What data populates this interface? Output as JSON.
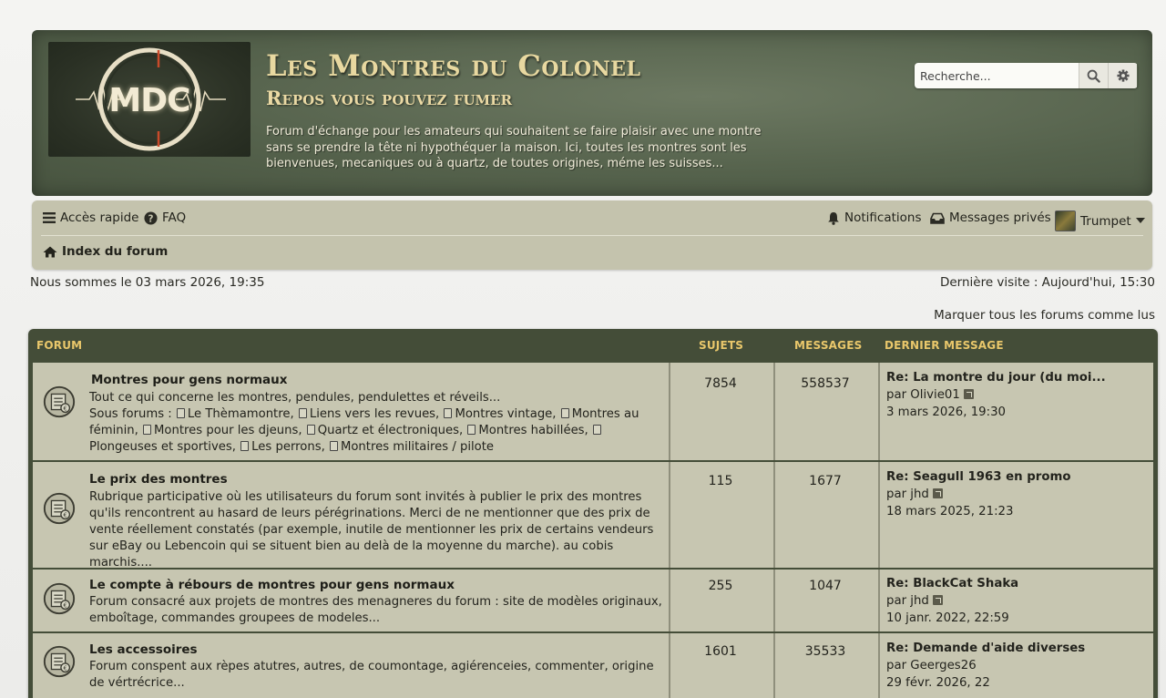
{
  "header": {
    "logo_text": "MDC",
    "title": "Les Montres du Colonel",
    "subtitle": "Repos vous pouvez fumer",
    "description": "Forum d'échange pour les amateurs qui souhaitent se faire plaisir avec une montre sans se prendre la tête ni hypothéquer la maison. Ici, toutes les montres sont les bienvenues, mecaniques ou à quartz, de toutes origines, méme les suisses...",
    "search_placeholder": "Recherche...",
    "search_icon": "search-icon",
    "advanced_search_icon": "gear-icon"
  },
  "nav": {
    "quick_access": "Accès rapide",
    "faq": "FAQ",
    "notifications": "Notifications",
    "private_messages": "Messages privés",
    "username": "Trumpet",
    "breadcrumb": "Index du forum"
  },
  "info": {
    "current_time": "Nous sommes le 03 mars 2026, 19:35",
    "last_visit": "Dernière visite : Aujourd'hui, 15:30",
    "mark_all_read": "Marquer tous les forums comme lus"
  },
  "table": {
    "col_forum": "FORUM",
    "col_topics": "SUJETS",
    "col_posts": "MESSAGES",
    "col_last": "DERNIER MESSAGE",
    "accent_color": "#e9c76b",
    "rows": [
      {
        "title": "Montres pour gens normaux",
        "description": "Tout ce qui concerne les montres, pendules, pendulettes et réveils...",
        "subforums_label": "Sous forums :",
        "subforums": [
          "Le Thèmamontre,",
          "Liens vers les revues,",
          "Montres vintage,",
          "Montres au féminin,",
          "Montres pour les djeuns,",
          "Quartz et électroniques,",
          "Montres habillées,",
          "Plongeuses et sportives,",
          "Les perrons,",
          "Montres militaires / pilote"
        ],
        "topics": "7854",
        "posts": "558537",
        "last_title": "Re: La montre du jour (du moi...",
        "last_by": "par Olivie01",
        "last_date": "3 mars 2026, 19:30"
      },
      {
        "title": "Le prix des montres",
        "description": "Rubrique participative où les utilisateurs du forum sont invités à publier le prix des montres qu'ils rencontrent au hasard de leurs pérégrinations. Merci de ne mentionner que des prix de vente réellement constatés (par exemple, inutile de mentionner les prix de certains vendeurs sur eBay ou Lebencoin qui se situent bien au delà de la moyenne du marche). au cobis marchis....",
        "topics": "115",
        "posts": "1677",
        "last_title": "Re: Seagull 1963 en promo",
        "last_by": "par jhd",
        "last_date": "18 mars 2025, 21:23"
      },
      {
        "title": "Le compte à rébours de montres pour gens normaux",
        "description": "Forum consacré aux projets de montres des menagneres du forum : site de modèles originaux, emboîtage, commandes groupees de modeles...",
        "topics": "255",
        "posts": "1047",
        "last_title": "Re: BlackCat Shaka",
        "last_by": "par jhd",
        "last_date": "10 janr. 2022, 22:59"
      },
      {
        "title": "Les accessoires",
        "description": "Forum conspent aux rèpes atutres, autres, de coumontage, agiérenceies, commenter, origine de vértrécrice...",
        "topics": "1601",
        "posts": "35533",
        "last_title": "Re: Demande d'aide diverses",
        "last_by": "par Geerges26",
        "last_date": "29 févr. 2026, 22"
      }
    ]
  }
}
